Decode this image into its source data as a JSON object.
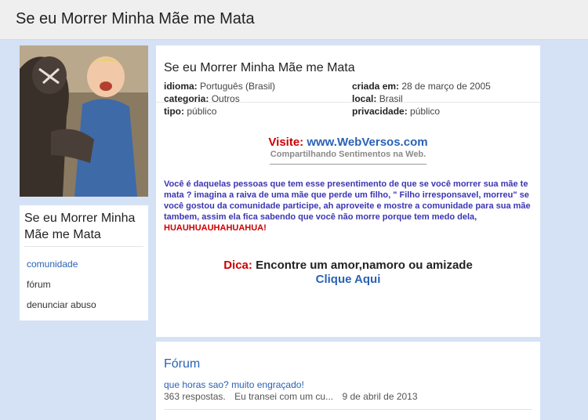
{
  "topbar": {
    "title": "Se eu Morrer Minha Mãe me Mata"
  },
  "sidebar": {
    "community_name": "Se eu Morrer Minha Mãe me Mata",
    "items": [
      {
        "label": "comunidade",
        "active": true
      },
      {
        "label": "fórum",
        "active": false
      },
      {
        "label": "denunciar abuso",
        "active": false
      }
    ]
  },
  "main": {
    "title": "Se eu Morrer Minha Mãe me Mata",
    "info": {
      "idioma_label": "idioma:",
      "idioma": "Português (Brasil)",
      "criada_label": "criada em:",
      "criada": "28 de março de 2005",
      "categoria_label": "categoria:",
      "categoria": "Outros",
      "local_label": "local:",
      "local": "Brasil",
      "tipo_label": "tipo:",
      "tipo": "público",
      "privacidade_label": "privacidade:",
      "privacidade": "público"
    },
    "visite_label": "Visite:",
    "visite_url": "www.WebVersos.com",
    "share_text": "Compartilhando Sentimentos na Web.",
    "description": "Você é daquelas pessoas que tem esse presentimento de que se você morrer sua mãe te mata ? imagina a raiva de uma mãe que perde um filho, \" Filho irresponsavel, morreu\" se você gostou da comunidade participe, ah aproveite e mostre a comunidade para sua mãe tambem, assim ela fica sabendo que você não morre porque tem medo dela, ",
    "description_laugh": "HUAUHUAUHAHUAHUA!",
    "dica_label": "Dica:",
    "dica_text": "Encontre um amor,namoro ou amizade",
    "dica_link": "Clique Aqui"
  },
  "forum": {
    "title": "Fórum",
    "topic": "que horas sao? muito engraçado!",
    "replies": "363 respostas.",
    "last_post": "Eu transei com um cu...",
    "date": "9 de abril de 2013"
  },
  "colors": {
    "accent": "#2a62b5",
    "red": "#cc0000",
    "desc": "#3b35b3",
    "background": "#d5e2f5"
  }
}
